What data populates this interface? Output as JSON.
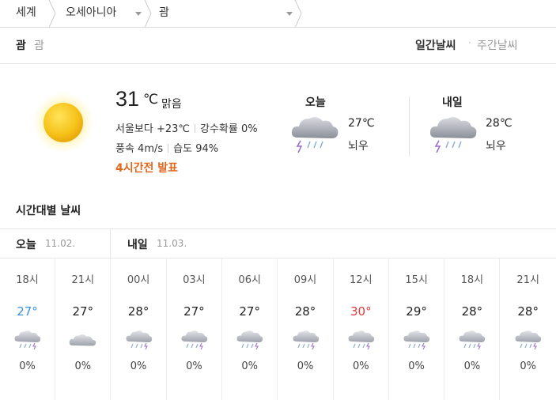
{
  "breadcrumb": {
    "level1": "세계",
    "level2": "오세아니아",
    "level3": "괌"
  },
  "header": {
    "location": "괌",
    "location_sub": "괌",
    "daily_tab": "일간날씨",
    "separator": "·",
    "weekly_tab": "주간날씨"
  },
  "current": {
    "temp": "31",
    "unit": "℃",
    "condition": "맑음",
    "vs_seoul": "서울보다 +23℃",
    "precip": "강수확률 0%",
    "wind": "풍속 4m/s",
    "humidity": "습도 94%",
    "updated": "4시간전 발표",
    "icon": "sun-icon"
  },
  "forecast": {
    "today": {
      "label": "오늘",
      "temp": "27℃",
      "desc": "뇌우",
      "icon": "thunderstorm-icon"
    },
    "tomorrow": {
      "label": "내일",
      "temp": "28℃",
      "desc": "뇌우",
      "icon": "thunderstorm-icon"
    }
  },
  "hourly": {
    "title": "시간대별 날씨",
    "days": [
      {
        "label": "오늘",
        "date": "11.02."
      },
      {
        "label": "내일",
        "date": "11.03."
      }
    ],
    "items": [
      {
        "time": "18시",
        "temp": "27°",
        "rain": "0%",
        "icon": "thunderstorm-icon",
        "color": "#3a8fdc"
      },
      {
        "time": "21시",
        "temp": "27°",
        "rain": "0%",
        "icon": "cloud-icon",
        "color": "#222222"
      },
      {
        "time": "00시",
        "temp": "28°",
        "rain": "0%",
        "icon": "thunderstorm-icon",
        "color": "#222222"
      },
      {
        "time": "03시",
        "temp": "27°",
        "rain": "0%",
        "icon": "thunderstorm-icon",
        "color": "#222222"
      },
      {
        "time": "06시",
        "temp": "27°",
        "rain": "0%",
        "icon": "thunderstorm-icon",
        "color": "#222222"
      },
      {
        "time": "09시",
        "temp": "28°",
        "rain": "0%",
        "icon": "thunderstorm-icon",
        "color": "#222222"
      },
      {
        "time": "12시",
        "temp": "30°",
        "rain": "0%",
        "icon": "thunderstorm-icon",
        "color": "#e03a3a"
      },
      {
        "time": "15시",
        "temp": "29°",
        "rain": "0%",
        "icon": "thunderstorm-icon",
        "color": "#222222"
      },
      {
        "time": "18시",
        "temp": "28°",
        "rain": "0%",
        "icon": "thunderstorm-icon",
        "color": "#222222"
      },
      {
        "time": "21시",
        "temp": "28°",
        "rain": "0%",
        "icon": "thunderstorm-icon",
        "color": "#222222"
      }
    ]
  }
}
